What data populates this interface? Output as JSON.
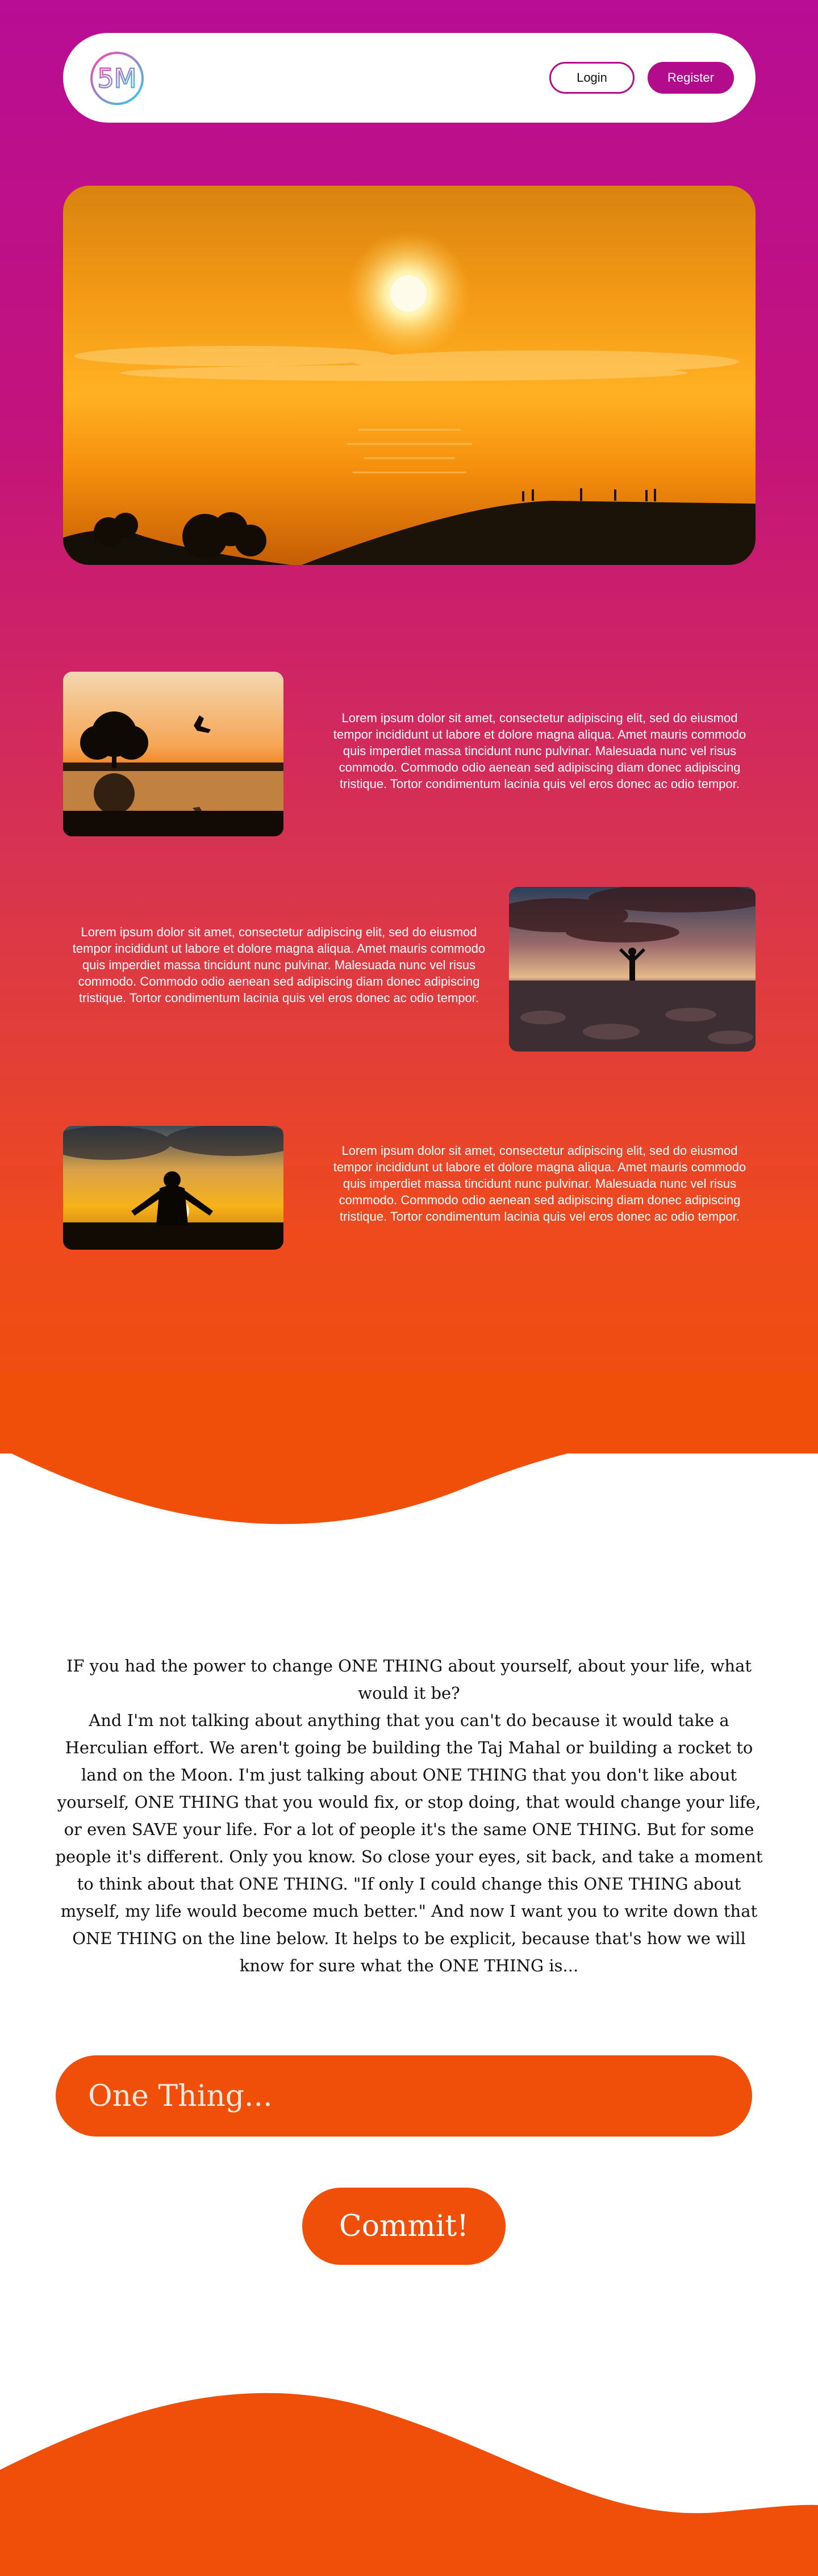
{
  "header": {
    "logo_text": "5M",
    "login_label": "Login",
    "register_label": "Register"
  },
  "features": [
    {
      "text": "Lorem ipsum dolor sit amet, consectetur adipiscing elit, sed do eiusmod tempor incididunt ut labore et dolore magna aliqua. Amet mauris commodo quis imperdiet massa tincidunt nunc pulvinar. Malesuada nunc vel risus commodo. Commodo odio aenean sed adipiscing diam donec adipiscing tristique. Tortor condimentum lacinia quis vel eros donec ac odio tempor."
    },
    {
      "text": "Lorem ipsum dolor sit amet, consectetur adipiscing elit, sed do eiusmod tempor incididunt ut labore et dolore magna aliqua. Amet mauris commodo quis imperdiet massa tincidunt nunc pulvinar. Malesuada nunc vel risus commodo. Commodo odio aenean sed adipiscing diam donec adipiscing tristique. Tortor condimentum lacinia quis vel eros donec ac odio tempor."
    },
    {
      "text": "Lorem ipsum dolor sit amet, consectetur adipiscing elit, sed do eiusmod tempor incididunt ut labore et dolore magna aliqua. Amet mauris commodo quis imperdiet massa tincidunt nunc pulvinar. Malesuada nunc vel risus commodo. Commodo odio aenean sed adipiscing diam donec adipiscing tristique. Tortor condimentum lacinia quis vel eros donec ac odio tempor."
    }
  ],
  "essay": {
    "question": "IF you had the power to change ONE THING about yourself, about your life, what would it be?",
    "body": "And I'm not talking about anything that you can't do because it would take a Herculian effort. We aren't going be building the Taj Mahal or building a rocket to land on the Moon. I'm just talking about ONE THING that you don't like about yourself, ONE THING that you would fix, or stop doing, that would change your life, or even SAVE your life. For a lot of people it's the same ONE THING. But for some people it's different. Only you know. So close your eyes, sit back, and take a moment to think about that ONE THING. \"If only I could change this ONE THING about myself, my life would become much better.\" And now I want you to write down that ONE THING on the line below. It helps to be explicit, because that's how we will know for sure what the ONE THING is..."
  },
  "form": {
    "one_thing_placeholder": "One Thing...",
    "commit_label": "Commit!"
  },
  "colors": {
    "brand": "#b20c8c",
    "accent": "#f04f0a"
  }
}
